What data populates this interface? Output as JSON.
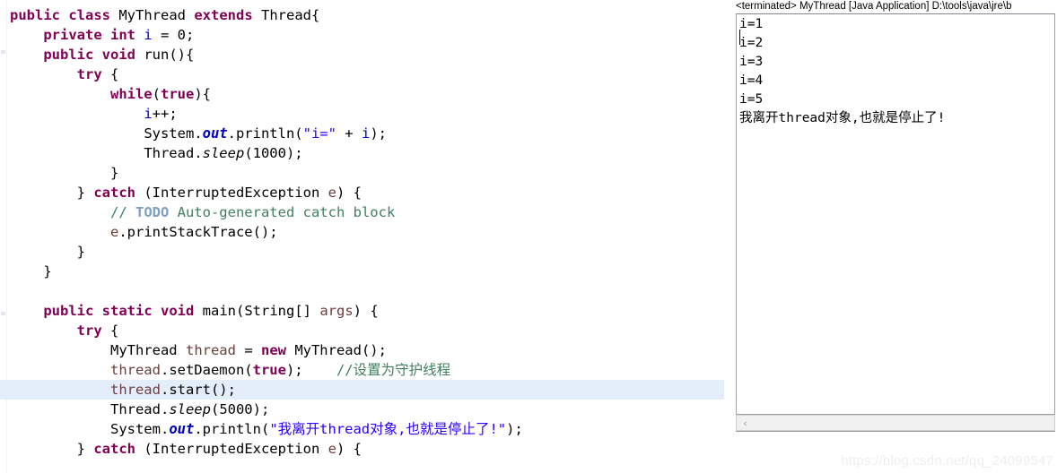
{
  "editor": {
    "name": "java-source-editor",
    "language": "Java",
    "highlighted_line_number": 20,
    "lines": [
      {
        "indent": 0,
        "tokens": [
          {
            "t": "kw",
            "v": "public"
          },
          {
            "t": "plain",
            "v": " "
          },
          {
            "t": "kw",
            "v": "class"
          },
          {
            "t": "plain",
            "v": " MyThread "
          },
          {
            "t": "kw",
            "v": "extends"
          },
          {
            "t": "plain",
            "v": " Thread{"
          }
        ]
      },
      {
        "indent": 1,
        "tokens": [
          {
            "t": "kw",
            "v": "private"
          },
          {
            "t": "plain",
            "v": " "
          },
          {
            "t": "kw",
            "v": "int"
          },
          {
            "t": "plain",
            "v": " "
          },
          {
            "t": "fld",
            "v": "i"
          },
          {
            "t": "plain",
            "v": " = 0;"
          }
        ]
      },
      {
        "indent": 1,
        "tokens": [
          {
            "t": "kw",
            "v": "public"
          },
          {
            "t": "plain",
            "v": " "
          },
          {
            "t": "kw",
            "v": "void"
          },
          {
            "t": "plain",
            "v": " run(){"
          }
        ]
      },
      {
        "indent": 2,
        "tokens": [
          {
            "t": "kw",
            "v": "try"
          },
          {
            "t": "plain",
            "v": " {"
          }
        ]
      },
      {
        "indent": 3,
        "tokens": [
          {
            "t": "kw",
            "v": "while"
          },
          {
            "t": "plain",
            "v": "("
          },
          {
            "t": "kw",
            "v": "true"
          },
          {
            "t": "plain",
            "v": "){"
          }
        ]
      },
      {
        "indent": 4,
        "tokens": [
          {
            "t": "fld",
            "v": "i"
          },
          {
            "t": "plain",
            "v": "++;"
          }
        ]
      },
      {
        "indent": 4,
        "tokens": [
          {
            "t": "plain",
            "v": "System."
          },
          {
            "t": "sfld",
            "v": "out"
          },
          {
            "t": "plain",
            "v": ".println("
          },
          {
            "t": "str",
            "v": "\"i=\""
          },
          {
            "t": "plain",
            "v": " + "
          },
          {
            "t": "fld",
            "v": "i"
          },
          {
            "t": "plain",
            "v": ");"
          }
        ]
      },
      {
        "indent": 4,
        "tokens": [
          {
            "t": "plain",
            "v": "Thread."
          },
          {
            "t": "smeth",
            "v": "sleep"
          },
          {
            "t": "plain",
            "v": "(1000);"
          }
        ]
      },
      {
        "indent": 3,
        "tokens": [
          {
            "t": "plain",
            "v": "}"
          }
        ]
      },
      {
        "indent": 2,
        "tokens": [
          {
            "t": "plain",
            "v": "} "
          },
          {
            "t": "kw",
            "v": "catch"
          },
          {
            "t": "plain",
            "v": " (InterruptedException "
          },
          {
            "t": "lvar",
            "v": "e"
          },
          {
            "t": "plain",
            "v": ") {"
          }
        ]
      },
      {
        "indent": 3,
        "tokens": [
          {
            "t": "cmt",
            "v": "// "
          },
          {
            "t": "todo",
            "v": "TODO"
          },
          {
            "t": "cmt",
            "v": " Auto-generated catch block"
          }
        ]
      },
      {
        "indent": 3,
        "tokens": [
          {
            "t": "lvar",
            "v": "e"
          },
          {
            "t": "plain",
            "v": ".printStackTrace();"
          }
        ]
      },
      {
        "indent": 2,
        "tokens": [
          {
            "t": "plain",
            "v": "}"
          }
        ]
      },
      {
        "indent": 1,
        "tokens": [
          {
            "t": "plain",
            "v": "}"
          }
        ]
      },
      {
        "indent": 0,
        "tokens": []
      },
      {
        "indent": 1,
        "tokens": [
          {
            "t": "kw",
            "v": "public"
          },
          {
            "t": "plain",
            "v": " "
          },
          {
            "t": "kw",
            "v": "static"
          },
          {
            "t": "plain",
            "v": " "
          },
          {
            "t": "kw",
            "v": "void"
          },
          {
            "t": "plain",
            "v": " main(String[] "
          },
          {
            "t": "lvar",
            "v": "args"
          },
          {
            "t": "plain",
            "v": ") {"
          }
        ]
      },
      {
        "indent": 2,
        "tokens": [
          {
            "t": "kw",
            "v": "try"
          },
          {
            "t": "plain",
            "v": " {"
          }
        ]
      },
      {
        "indent": 3,
        "tokens": [
          {
            "t": "plain",
            "v": "MyThread "
          },
          {
            "t": "lvar",
            "v": "thread"
          },
          {
            "t": "plain",
            "v": " = "
          },
          {
            "t": "kw",
            "v": "new"
          },
          {
            "t": "plain",
            "v": " MyThread();"
          }
        ]
      },
      {
        "indent": 3,
        "tokens": [
          {
            "t": "lvar",
            "v": "thread"
          },
          {
            "t": "plain",
            "v": ".setDaemon("
          },
          {
            "t": "kw",
            "v": "true"
          },
          {
            "t": "plain",
            "v": ");    "
          },
          {
            "t": "cmt",
            "v": "//设置为守护线程"
          }
        ]
      },
      {
        "indent": 3,
        "highlight": true,
        "tokens": [
          {
            "t": "lvar",
            "v": "thread"
          },
          {
            "t": "plain",
            "v": ".start();"
          }
        ]
      },
      {
        "indent": 3,
        "tokens": [
          {
            "t": "plain",
            "v": "Thread."
          },
          {
            "t": "smeth",
            "v": "sleep"
          },
          {
            "t": "plain",
            "v": "(5000);"
          }
        ]
      },
      {
        "indent": 3,
        "tokens": [
          {
            "t": "plain",
            "v": "System."
          },
          {
            "t": "sfld",
            "v": "out"
          },
          {
            "t": "plain",
            "v": ".println("
          },
          {
            "t": "str",
            "v": "\"我离开thread对象,也就是停止了!\""
          },
          {
            "t": "plain",
            "v": ");"
          }
        ]
      },
      {
        "indent": 2,
        "tokens": [
          {
            "t": "plain",
            "v": "} "
          },
          {
            "t": "kw",
            "v": "catch"
          },
          {
            "t": "plain",
            "v": " (InterruptedException "
          },
          {
            "t": "lvar",
            "v": "e"
          },
          {
            "t": "plain",
            "v": ") {"
          }
        ]
      }
    ]
  },
  "console": {
    "header": "<terminated> MyThread [Java Application] D:\\tools\\java\\jre\\b",
    "output_lines": [
      "i=1",
      "i=2",
      "i=3",
      "i=4",
      "i=5",
      "我离开thread对象,也就是停止了!"
    ],
    "hscroll_left_arrow": "‹"
  },
  "watermark": {
    "text": "https://blog.csdn.net/qq_24099547"
  },
  "colors": {
    "keyword": "#7f0055",
    "string": "#2a00ff",
    "field": "#0000c0",
    "local_variable": "#6a3e3e",
    "comment": "#3f7f5f",
    "todo_tag": "#7f9fbf",
    "highlight_line": "#e4eefb",
    "console_border": "#a0a0a0",
    "scrollbar_track": "#f0f0f0",
    "watermark": "#eeeeee"
  }
}
